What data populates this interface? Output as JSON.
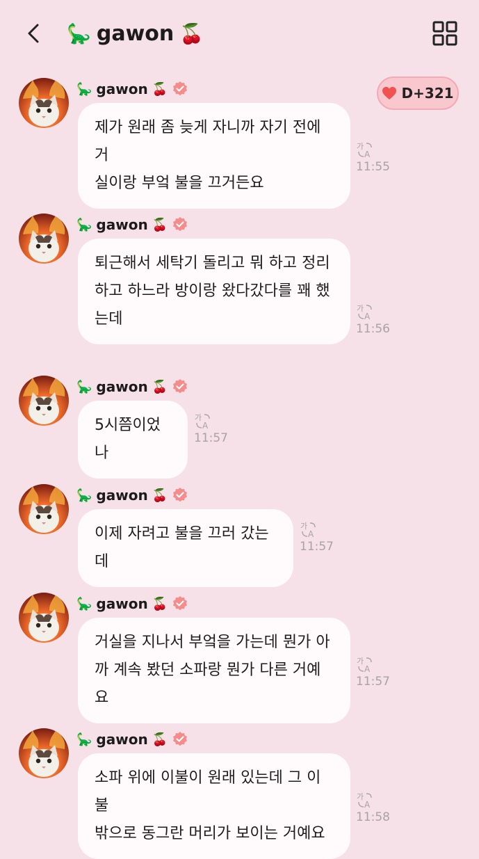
{
  "header": {
    "title": "gawon",
    "title_emoji_left": "🦕",
    "title_emoji_right": "🍒",
    "back_icon": "chevron-left-icon",
    "menu_icon": "grid-icon"
  },
  "badge": {
    "label": "D+321",
    "icon": "heart-icon",
    "color": "#f2524f"
  },
  "colors": {
    "background": "#f6e1e9",
    "bubble": "#fffafb",
    "verified": "#f58b8b"
  },
  "messages": [
    {
      "sender": "gawon",
      "emoji_left": "🦕",
      "emoji_right": "🍒",
      "time": "11:55",
      "lines": [
        "제가 원래 좀 늦게 자니까 자기 전에 거",
        "실이랑 부엌 불을 끄거든요"
      ]
    },
    {
      "sender": "gawon",
      "emoji_left": "🦕",
      "emoji_right": "🍒",
      "time": "11:56",
      "lines": [
        "퇴근해서 세탁기 돌리고 뭐 하고 정리",
        "하고 하느라 방이랑 왔다갔다를 꽤 했",
        "는데"
      ]
    },
    {
      "sender": "gawon",
      "emoji_left": "🦕",
      "emoji_right": "🍒",
      "time": "11:57",
      "lines": [
        "5시쯤이었나"
      ]
    },
    {
      "sender": "gawon",
      "emoji_left": "🦕",
      "emoji_right": "🍒",
      "time": "11:57",
      "lines": [
        "이제 자려고 불을 끄러 갔는데"
      ]
    },
    {
      "sender": "gawon",
      "emoji_left": "🦕",
      "emoji_right": "🍒",
      "time": "11:57",
      "lines": [
        "거실을 지나서 부엌을 가는데 뭔가 아",
        "까 계속 봤던 소파랑 뭔가 다른 거예요"
      ]
    },
    {
      "sender": "gawon",
      "emoji_left": "🦕",
      "emoji_right": "🍒",
      "time": "11:58",
      "lines": [
        "소파 위에 이불이 원래 있는데 그 이불",
        "밖으로 동그란 머리가 보이는 거예요"
      ]
    }
  ]
}
